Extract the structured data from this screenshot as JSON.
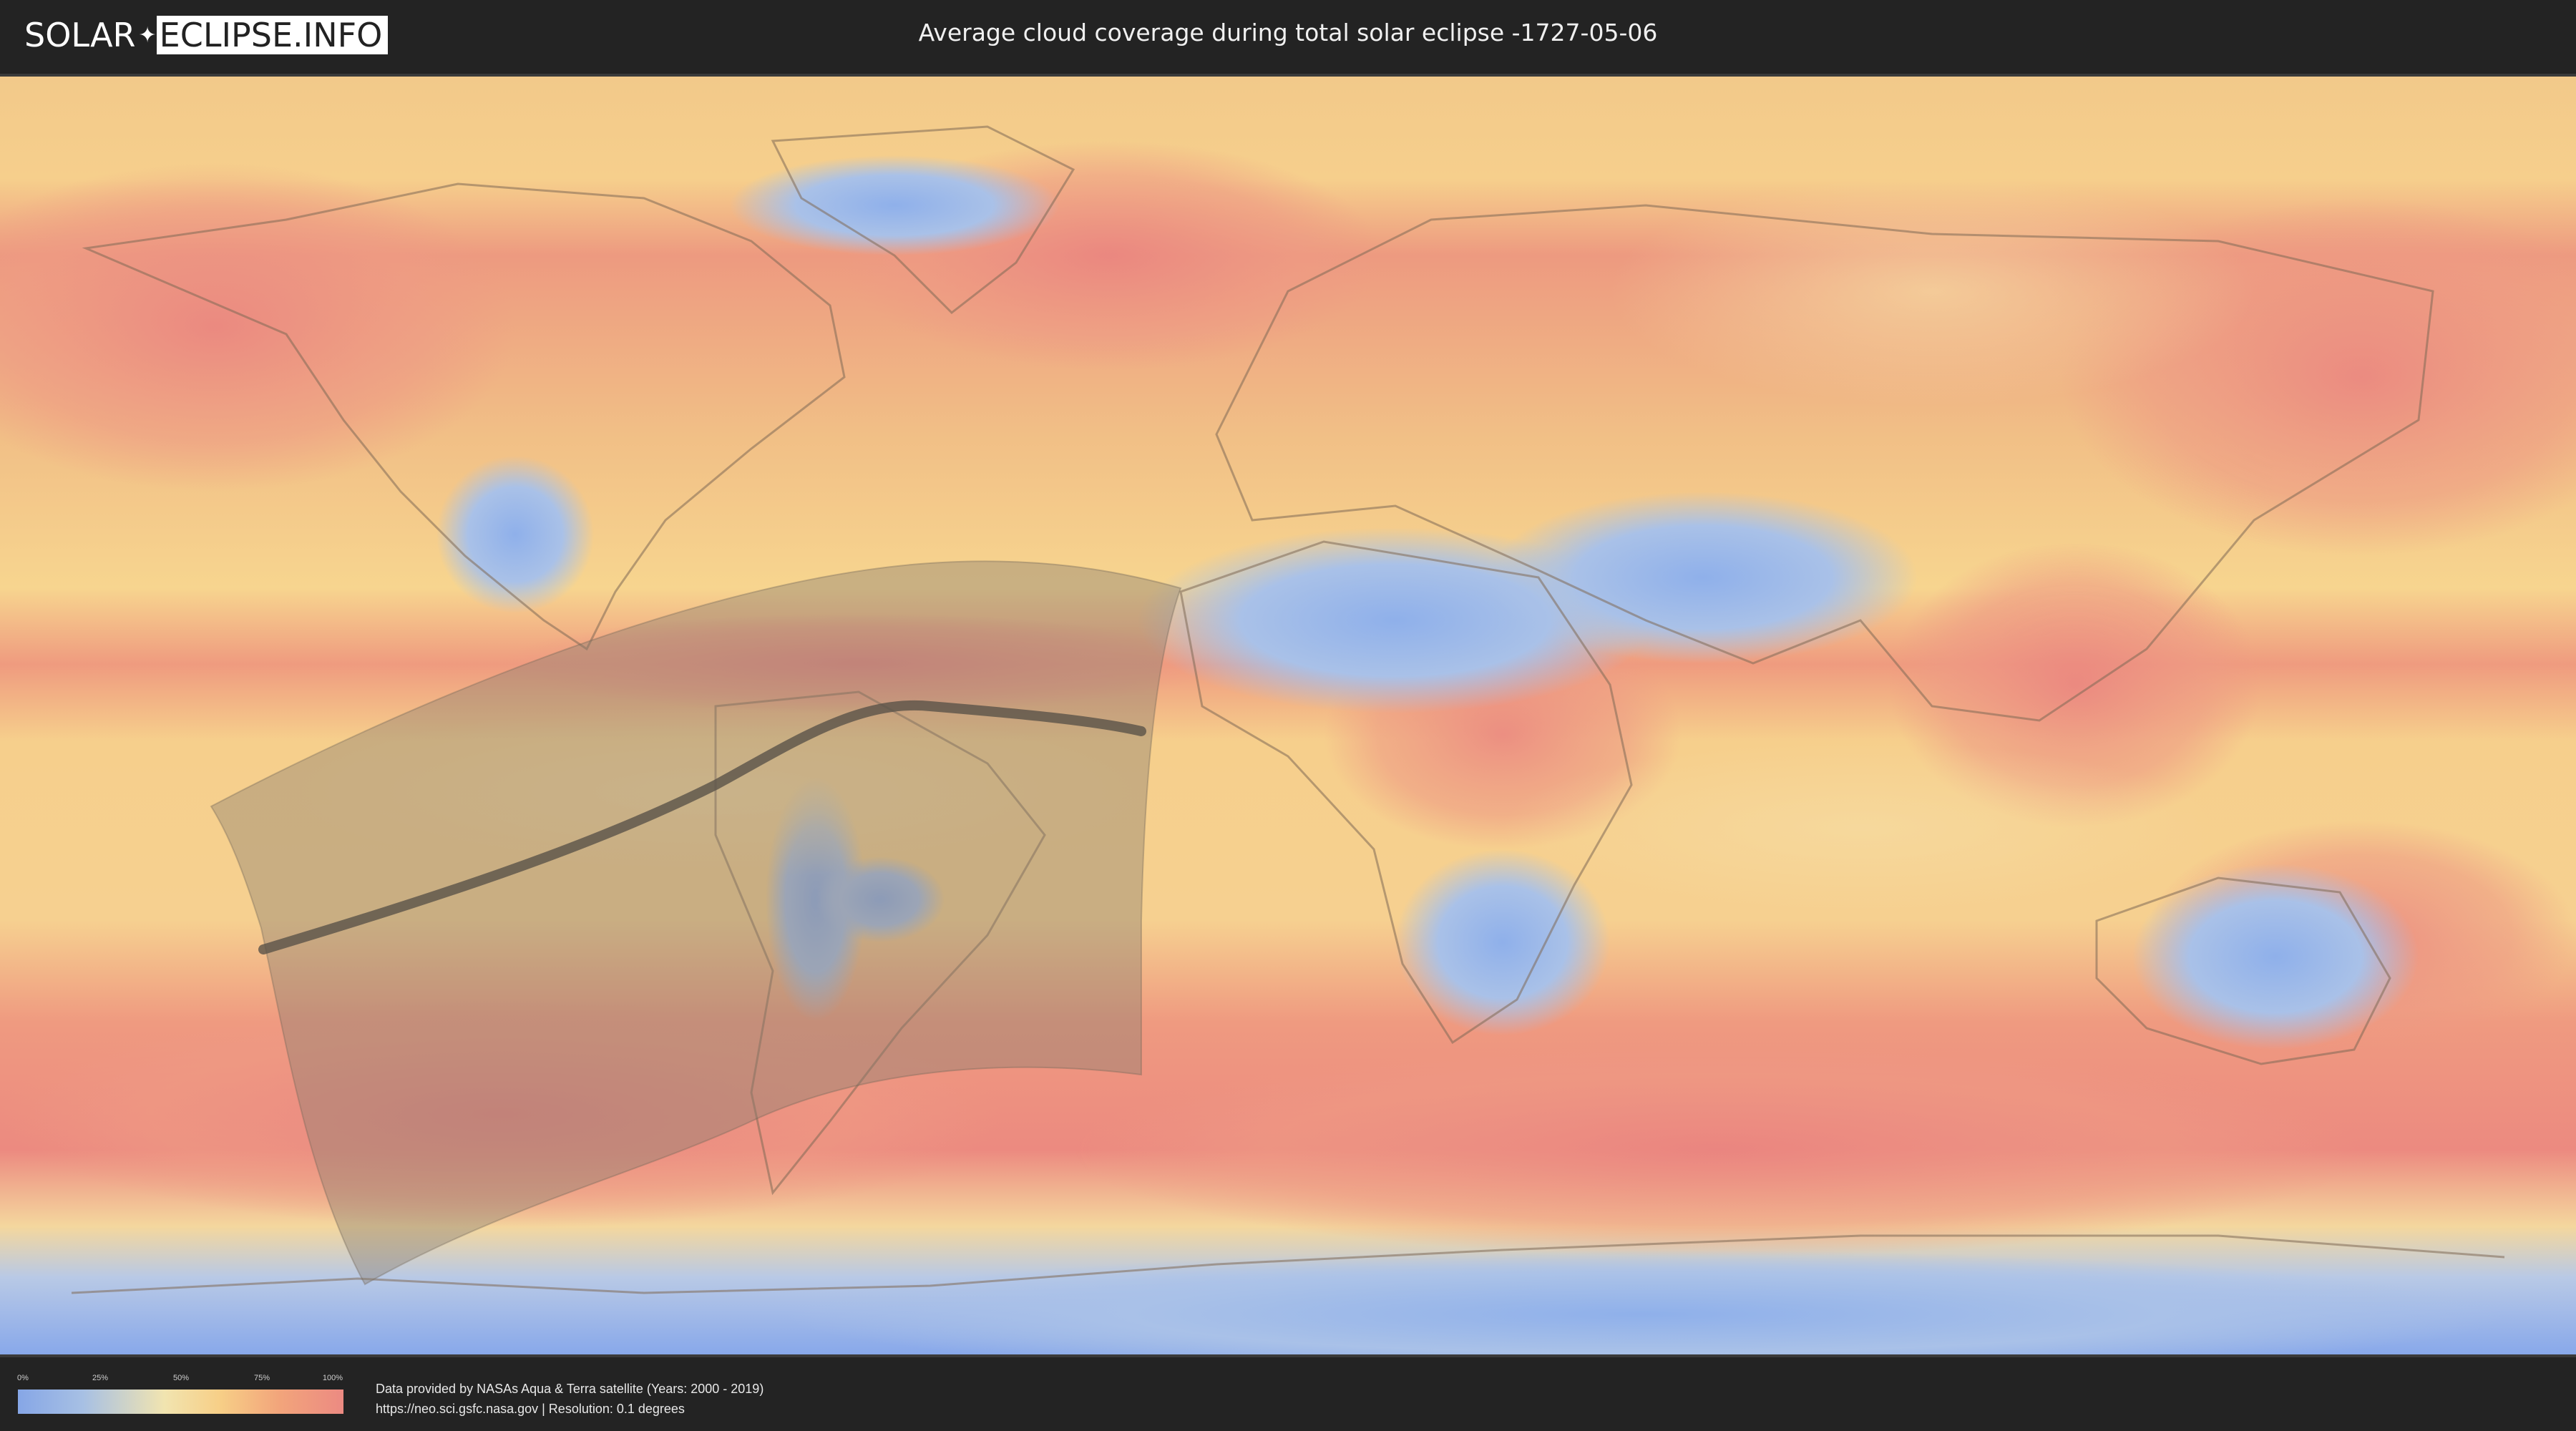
{
  "header": {
    "logo_part1": "SOLAR",
    "logo_part2": "ECLIPSE.INFO",
    "title": "Average cloud coverage during total solar eclipse -1727-05-06"
  },
  "legend": {
    "ticks": [
      "0%",
      "25%",
      "50%",
      "75%",
      "100%"
    ],
    "scale_colors": [
      "#86a6e6",
      "#a7c0e4",
      "#f1e4b0",
      "#f7cf87",
      "#f2a57b",
      "#ec8a82"
    ]
  },
  "credits": {
    "line1": "Data provided by NASAs Aqua & Terra satellite (Years: 2000 - 2019)",
    "line2": "https://neo.sci.gsfc.nasa.gov | Resolution: 0.1 degrees"
  },
  "map": {
    "projection": "equirectangular world map",
    "layer": "cloud coverage",
    "overlay": "eclipse visibility zone with central path of totality"
  },
  "colors": {
    "clear": "#8fb0e8",
    "low": "#bcd0e6",
    "mid": "#f4dea8",
    "high": "#f6c080",
    "cloudy": "#ec8a80",
    "overlay": "#8a7f70",
    "path": "#5a5248"
  }
}
